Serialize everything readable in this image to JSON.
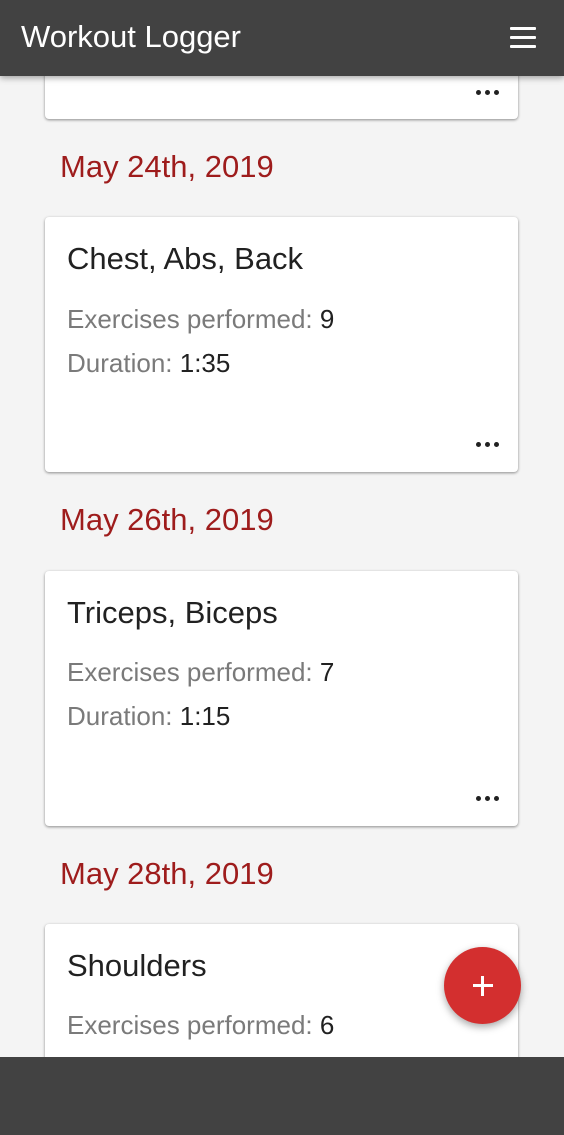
{
  "app": {
    "title": "Workout Logger"
  },
  "header": {
    "menu_icon": "menu-icon"
  },
  "workouts": [
    {
      "date": "May 24th, 2019",
      "title": "Chest, Abs, Back",
      "exercises_label": "Exercises performed:",
      "exercises_value": "9",
      "duration_label": "Duration:",
      "duration_value": "1:35"
    },
    {
      "date": "May 26th, 2019",
      "title": "Triceps, Biceps",
      "exercises_label": "Exercises performed:",
      "exercises_value": "7",
      "duration_label": "Duration:",
      "duration_value": "1:15"
    },
    {
      "date": "May 28th, 2019",
      "title": "Shoulders",
      "exercises_label": "Exercises performed:",
      "exercises_value": "6"
    }
  ],
  "fab": {
    "label": "+",
    "icon": "plus-icon",
    "color": "#d32f2f"
  },
  "colors": {
    "appbar": "#424242",
    "date_accent": "#9e1c1c",
    "background": "#f4f4f4"
  }
}
